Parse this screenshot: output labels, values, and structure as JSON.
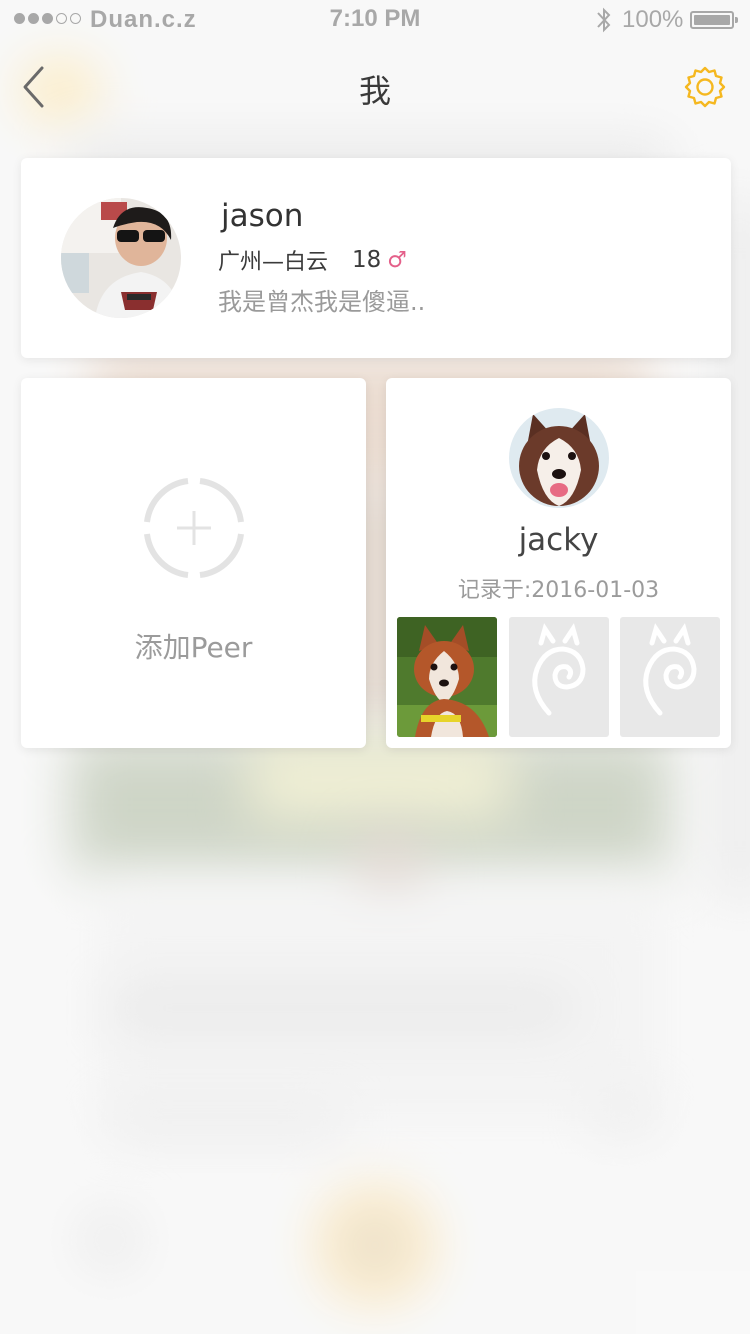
{
  "status_bar": {
    "carrier": "Duan.c.z",
    "time": "7:10 PM",
    "battery_percent": "100%",
    "signal_bars_filled": 3,
    "signal_bars_total": 5
  },
  "nav": {
    "title": "我",
    "back_icon": "chevron-left-icon",
    "settings_icon": "gear-icon",
    "accent_color": "#f5b820"
  },
  "profile": {
    "name": "jason",
    "location": "广州—白云",
    "age": "18",
    "gender_symbol": "♂",
    "gender_color": "#e4608a",
    "bio": "我是曾杰我是傻逼.."
  },
  "add_peer": {
    "label": "添加Peer",
    "icon": "add-circle-icon"
  },
  "pet": {
    "name": "jacky",
    "record_label": "记录于:",
    "record_date": "2016-01-03",
    "photo_placeholder_icon": "swirl-placeholder-icon"
  }
}
